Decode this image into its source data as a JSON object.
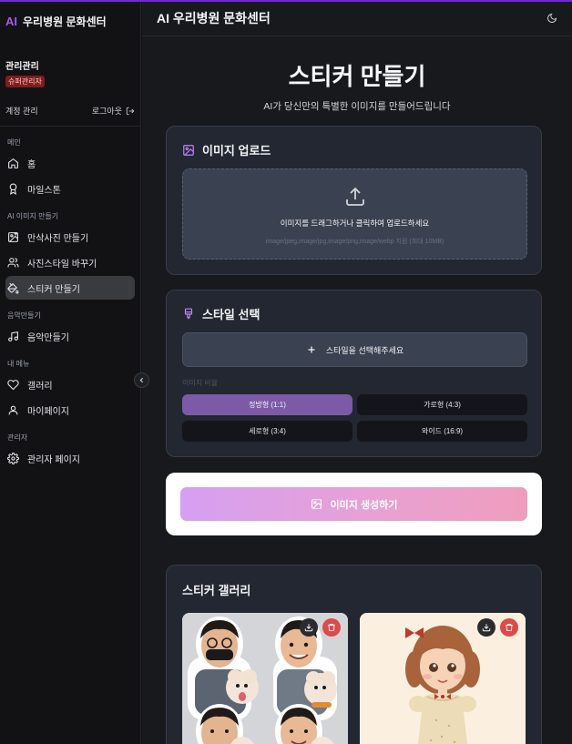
{
  "brand": {
    "logo": "AI",
    "name": "우리병원 문화센터"
  },
  "user": {
    "name": "관리관리",
    "badge": "슈퍼관리자"
  },
  "account": {
    "label": "계정 관리",
    "logout": "로그아웃"
  },
  "sidebar": {
    "sections": [
      {
        "label": "메인",
        "items": [
          {
            "label": "홈",
            "icon": "home-icon"
          },
          {
            "label": "마일스톤",
            "icon": "award-icon"
          }
        ]
      },
      {
        "label": "AI 이미지 만들기",
        "items": [
          {
            "label": "만삭사진 만들기",
            "icon": "image-plus-icon"
          },
          {
            "label": "사진스타일 바꾸기",
            "icon": "users-icon"
          },
          {
            "label": "스티커 만들기",
            "icon": "paint-bucket-icon",
            "active": true
          }
        ]
      },
      {
        "label": "음악만들기",
        "items": [
          {
            "label": "음악만들기",
            "icon": "music-icon"
          }
        ]
      },
      {
        "label": "내 메뉴",
        "items": [
          {
            "label": "갤러리",
            "icon": "heart-icon"
          },
          {
            "label": "마이페이지",
            "icon": "user-icon"
          }
        ]
      },
      {
        "label": "관리자",
        "items": [
          {
            "label": "관리자 페이지",
            "icon": "settings-icon"
          }
        ]
      }
    ]
  },
  "header": {
    "title": "AI 우리병원 문화센터",
    "theme_icon": "moon-icon"
  },
  "hero": {
    "title": "스티커 만들기",
    "subtitle": "AI가 당신만의 특별한 이미지를 만들어드립니다"
  },
  "upload": {
    "title": "이미지 업로드",
    "drop_text": "이미지를 드래그하거나 클릭하여 업로드하세요",
    "formats": "image/jpeg,image/jpg,image/png,image/webp 지원 (최대 10MB)"
  },
  "style": {
    "title": "스타일 선택",
    "select_label": "스타일을 선택해주세요",
    "ratio_label": "이미지 비율",
    "ratios": [
      {
        "label": "정방형 (1:1)",
        "selected": true
      },
      {
        "label": "가로형 (4:3)",
        "selected": false
      },
      {
        "label": "세로형 (3:4)",
        "selected": false
      },
      {
        "label": "와이드 (16:9)",
        "selected": false
      }
    ]
  },
  "generate": {
    "label": "이미지 생성하기"
  },
  "gallery": {
    "title": "스티커 갤러리"
  },
  "colors": {
    "accent": "#a855f7",
    "selected_ratio": "#7c5aa8",
    "delete": "#dc4a4a"
  }
}
